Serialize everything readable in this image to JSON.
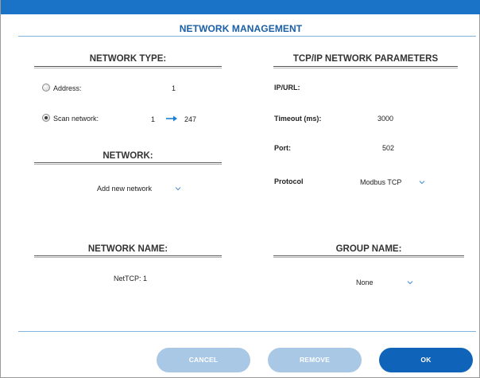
{
  "dialog": {
    "title": "NETWORK MANAGEMENT"
  },
  "network_type": {
    "heading": "NETWORK TYPE:",
    "address_label": "Address:",
    "address_value": "1",
    "address_checked": false,
    "scan_label": "Scan network:",
    "scan_from": "1",
    "scan_to": "247",
    "scan_checked": true
  },
  "network": {
    "heading": "NETWORK:",
    "selected": "Add new network"
  },
  "network_name": {
    "heading": "NETWORK NAME:",
    "value": "NetTCP: 1"
  },
  "tcpip": {
    "heading": "TCP/IP NETWORK PARAMETERS",
    "ip_label": "IP/URL:",
    "ip_value": "",
    "timeout_label": "Timeout (ms):",
    "timeout_value": "3000",
    "port_label": "Port:",
    "port_value": "502",
    "protocol_label": "Protocol",
    "protocol_value": "Modbus TCP"
  },
  "group_name": {
    "heading": "GROUP NAME:",
    "selected": "None"
  },
  "buttons": {
    "cancel": "CANCEL",
    "remove": "REMOVE",
    "ok": "OK"
  },
  "colors": {
    "accent": "#1a73c6",
    "primary_button": "#0f63b8",
    "disabled_button": "#a9c8e6"
  }
}
